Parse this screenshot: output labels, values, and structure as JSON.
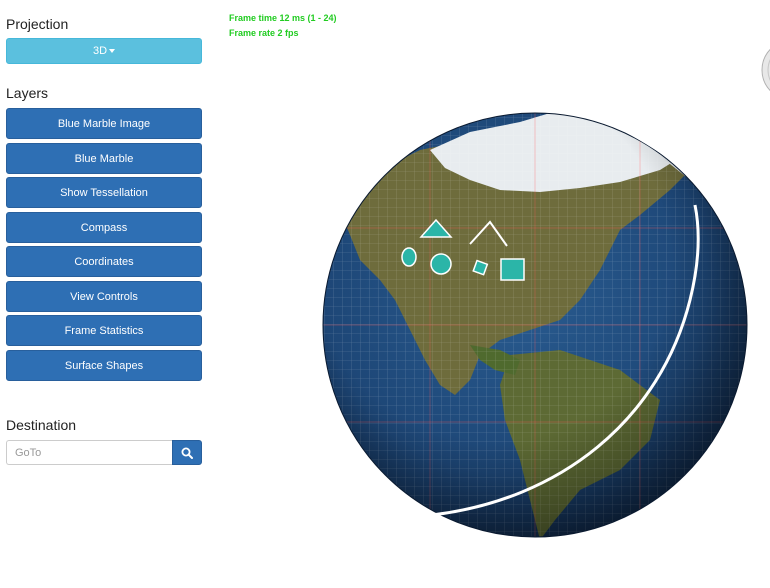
{
  "sidebar": {
    "projection_heading": "Projection",
    "projection_value": "3D",
    "layers_heading": "Layers",
    "layers": [
      {
        "label": "Blue Marble Image"
      },
      {
        "label": "Blue Marble"
      },
      {
        "label": "Show Tessellation"
      },
      {
        "label": "Compass"
      },
      {
        "label": "Coordinates"
      },
      {
        "label": "View Controls"
      },
      {
        "label": "Frame Statistics"
      },
      {
        "label": "Surface Shapes"
      }
    ],
    "destination_heading": "Destination",
    "goto_placeholder": "GoTo"
  },
  "frame_stats": {
    "frame_time": "Frame time  12 ms  (1 - 24)",
    "frame_rate": "Frame rate  2 fps"
  },
  "colors": {
    "projection_button": "#5bc0de",
    "layer_button": "#2e6fb4",
    "stats_text": "#22cc22",
    "ocean": "#1f4a7a",
    "land": "#6b6a3a",
    "surface_shape": "#2bb5a8"
  },
  "icons": {
    "projection_caret": "caret-down-icon",
    "goto": "search-icon",
    "compass": "compass-icon"
  }
}
